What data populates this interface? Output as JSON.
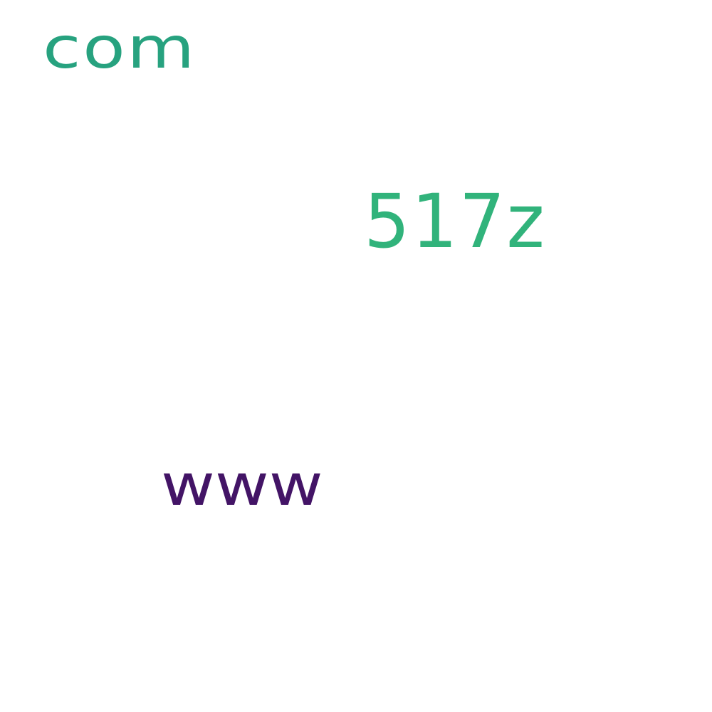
{
  "words": [
    {
      "text": "com",
      "color": "#27a27f"
    },
    {
      "text": "517z",
      "color": "#31b37b"
    },
    {
      "text": "www",
      "color": "#431466"
    }
  ]
}
